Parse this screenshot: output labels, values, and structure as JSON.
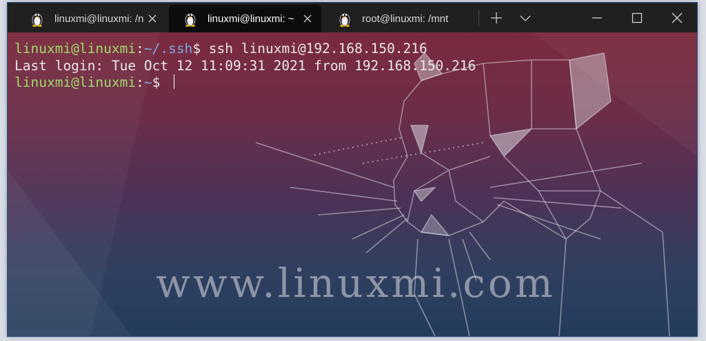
{
  "tabs": [
    {
      "label": "linuxmi@linuxmi: /n",
      "active": false,
      "icon": "tux-icon"
    },
    {
      "label": "linuxmi@linuxmi: ~",
      "active": true,
      "icon": "tux-icon"
    },
    {
      "label": "root@linuxmi: /mnt",
      "active": false,
      "icon": "tux-icon"
    }
  ],
  "window_controls": [
    "new-tab-icon",
    "dropdown-chevron-icon",
    "minimize-icon",
    "maximize-icon",
    "close-icon"
  ],
  "terminal": {
    "line1": {
      "user": "linuxmi@linuxmi",
      "colon": ":",
      "path": "~/.ssh",
      "prompt": "$",
      "command": " ssh linuxmi@192.168.150.216"
    },
    "line2": "Last login: Tue Oct 12 11:09:31 2021 from 192.168.150.216",
    "line3": {
      "user": "linuxmi@linuxmi",
      "colon": ":",
      "path": "~",
      "prompt": "$ "
    }
  },
  "watermark": "www.linuxmi.com",
  "colors": {
    "user": "#9fd96a",
    "path": "#7aa7e8",
    "titlebar": "#202020",
    "active_tab": "#0c0c0c"
  }
}
